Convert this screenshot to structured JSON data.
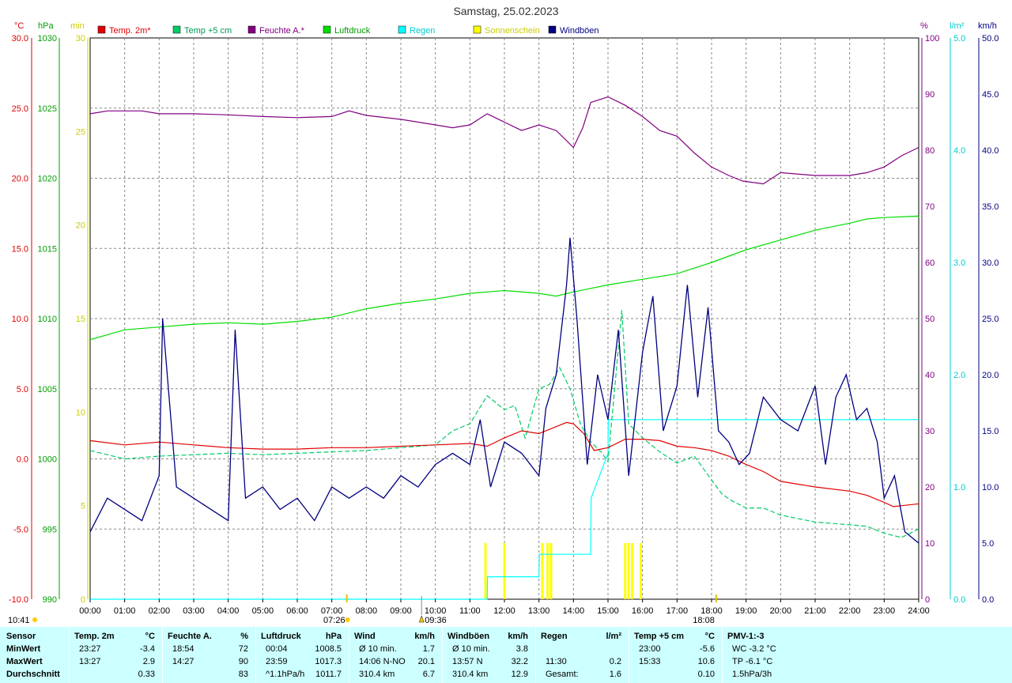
{
  "title": "Samstag, 25.02.2023",
  "legend": [
    {
      "label": "Temp. 2m*",
      "color": "#e00000",
      "text_color": "#e00000"
    },
    {
      "label": "Temp +5 cm",
      "color": "#00cc66",
      "text_color": "#009955"
    },
    {
      "label": "Feuchte A.*",
      "color": "#800080",
      "text_color": "#800080"
    },
    {
      "label": "Luftdruck",
      "color": "#00dd00",
      "text_color": "#009900"
    },
    {
      "label": "Regen",
      "color": "#00ffff",
      "text_color": "#00cccc"
    },
    {
      "label": "Sonnenschein",
      "color": "#ffff00",
      "text_color": "#cccc00"
    },
    {
      "label": "Windböen",
      "color": "#000080",
      "text_color": "#000080"
    }
  ],
  "axes": {
    "temp": {
      "unit": "°C",
      "color": "#e00000",
      "ticks": [
        "30.0",
        "25.0",
        "20.0",
        "15.0",
        "10.0",
        "5.0",
        "0.0",
        "-5.0",
        "-10.0"
      ]
    },
    "pressure": {
      "unit": "hPa",
      "color": "#00a000",
      "ticks": [
        "1030",
        "1025",
        "1020",
        "1015",
        "1010",
        "1005",
        "1000",
        "995",
        "990"
      ]
    },
    "sunmin": {
      "unit": "min",
      "color": "#cccc00",
      "ticks": [
        "30",
        "25",
        "20",
        "15",
        "10",
        "5",
        "0"
      ]
    },
    "humidity": {
      "unit": "%",
      "color": "#800080",
      "ticks": [
        "100",
        "90",
        "80",
        "70",
        "60",
        "50",
        "40",
        "30",
        "20",
        "10",
        "0"
      ]
    },
    "rain": {
      "unit": "l/m²",
      "color": "#00cccc",
      "ticks": [
        "5.0",
        "4.0",
        "3.0",
        "2.0",
        "1.0",
        "0.0"
      ]
    },
    "wind": {
      "unit": "km/h",
      "color": "#000080",
      "ticks": [
        "50.0",
        "45.0",
        "40.0",
        "35.0",
        "30.0",
        "25.0",
        "20.0",
        "15.0",
        "10.0",
        "5.0",
        "0.0"
      ]
    }
  },
  "x_ticks": [
    "00:00",
    "01:00",
    "02:00",
    "03:00",
    "04:00",
    "05:00",
    "06:00",
    "07:00",
    "08:00",
    "09:00",
    "10:00",
    "11:00",
    "12:00",
    "13:00",
    "14:00",
    "15:00",
    "16:00",
    "17:00",
    "18:00",
    "19:00",
    "20:00",
    "21:00",
    "22:00",
    "23:00",
    "24:00"
  ],
  "time_markers": {
    "now": "10:41",
    "sunrise": "07:26",
    "noon": "09:36",
    "sunset": "18:08"
  },
  "chart_data": {
    "type": "line",
    "x_range": [
      "00:00",
      "24:00"
    ],
    "grid": true,
    "legend_position": "top",
    "series": [
      {
        "name": "Temp. 2m*",
        "unit": "°C",
        "x": [
          0,
          1,
          2,
          3,
          4,
          5,
          6,
          7,
          8,
          9,
          10,
          11,
          11.5,
          12,
          12.5,
          13,
          13.5,
          13.8,
          14,
          14.3,
          14.6,
          15,
          15.5,
          16,
          16.5,
          17,
          17.5,
          18,
          18.5,
          19,
          19.5,
          20,
          21,
          22,
          22.5,
          23,
          23.27,
          24
        ],
        "y": [
          1.3,
          1.0,
          1.2,
          1.0,
          0.8,
          0.7,
          0.7,
          0.8,
          0.8,
          0.9,
          1.0,
          1.1,
          0.9,
          1.5,
          2.0,
          1.8,
          2.3,
          2.6,
          2.5,
          1.8,
          0.6,
          0.8,
          1.4,
          1.4,
          1.3,
          0.9,
          0.8,
          0.6,
          0.2,
          -0.4,
          -0.9,
          -1.6,
          -2.0,
          -2.3,
          -2.6,
          -3.1,
          -3.4,
          -3.2
        ]
      },
      {
        "name": "Temp +5 cm",
        "unit": "°C",
        "x": [
          0,
          0.5,
          1,
          2,
          3,
          4,
          5,
          6,
          7,
          8,
          9,
          10,
          10.5,
          11,
          11.5,
          12,
          12.3,
          12.6,
          13,
          13.3,
          13.6,
          13.9,
          14.2,
          14.5,
          14.8,
          15,
          15.4,
          15.6,
          16,
          16.5,
          17,
          17.5,
          18,
          18.3,
          18.6,
          19,
          19.5,
          20,
          21,
          22,
          22.5,
          23,
          23.5,
          24
        ],
        "y": [
          0.6,
          0.3,
          0.0,
          0.2,
          0.3,
          0.4,
          0.3,
          0.4,
          0.5,
          0.6,
          0.8,
          1.0,
          2.0,
          2.5,
          4.5,
          3.5,
          3.8,
          1.5,
          5.0,
          5.3,
          6.5,
          5.0,
          2.5,
          1.2,
          0.5,
          -0.2,
          10.6,
          2.5,
          1.5,
          0.5,
          -0.3,
          0.2,
          -1.5,
          -2.5,
          -3.0,
          -3.5,
          -3.5,
          -4.0,
          -4.5,
          -4.7,
          -4.8,
          -5.3,
          -5.6,
          -5.0
        ]
      },
      {
        "name": "Feuchte A.*",
        "unit": "%",
        "x": [
          0,
          0.5,
          1,
          1.5,
          2,
          3,
          4,
          5,
          6,
          7,
          7.5,
          8,
          9,
          10,
          10.5,
          11,
          11.5,
          12,
          12.5,
          13,
          13.5,
          14,
          14.27,
          14.5,
          15,
          15.5,
          16,
          16.5,
          17,
          17.5,
          18,
          18.5,
          18.9,
          19.5,
          20,
          21,
          22,
          22.5,
          23,
          23.5,
          24
        ],
        "y": [
          86.5,
          87,
          87,
          87,
          86.5,
          86.5,
          86.3,
          86,
          85.8,
          86,
          87,
          86.2,
          85.5,
          84.5,
          84,
          84.5,
          86.5,
          85,
          83.5,
          84.5,
          83.5,
          80.5,
          84,
          88.5,
          89.5,
          88,
          86,
          83.5,
          82.5,
          79.5,
          77,
          75.5,
          74.5,
          74,
          76,
          75.5,
          75.5,
          76,
          77,
          79,
          80.5
        ]
      },
      {
        "name": "Luftdruck",
        "unit": "hPa",
        "x": [
          0,
          0.004,
          1,
          2,
          3,
          4,
          5,
          6,
          7,
          8,
          9,
          10,
          11,
          12,
          13,
          13.5,
          14,
          15,
          16,
          17,
          18,
          19,
          20,
          21,
          22,
          22.5,
          23,
          23.98,
          24
        ],
        "y": [
          1008.5,
          1008.5,
          1009.2,
          1009.4,
          1009.6,
          1009.7,
          1009.6,
          1009.8,
          1010.1,
          1010.7,
          1011.1,
          1011.4,
          1011.8,
          1012.0,
          1011.8,
          1011.6,
          1011.9,
          1012.4,
          1012.8,
          1013.2,
          1014.0,
          1014.9,
          1015.6,
          1016.3,
          1016.8,
          1017.1,
          1017.2,
          1017.3,
          1017.2
        ]
      },
      {
        "name": "Regen",
        "unit": "l/m²",
        "x": [
          0,
          11.5,
          11.51,
          13.0,
          13.01,
          14.5,
          14.51,
          15.0,
          15.01,
          16.0,
          24
        ],
        "y": [
          0,
          0,
          0.2,
          0.2,
          0.4,
          0.4,
          0.9,
          1.3,
          1.6,
          1.6,
          1.6
        ]
      },
      {
        "name": "Sonnenschein",
        "unit": "min",
        "bars": [
          [
            11.45,
            3
          ],
          [
            12.0,
            3
          ],
          [
            13.1,
            3
          ],
          [
            13.25,
            3
          ],
          [
            13.35,
            3
          ],
          [
            15.5,
            3
          ],
          [
            15.6,
            3
          ],
          [
            15.7,
            3
          ],
          [
            15.95,
            3
          ]
        ]
      },
      {
        "name": "Windböen",
        "unit": "km/h",
        "x": [
          0,
          0.5,
          1,
          1.5,
          2,
          2.1,
          2.5,
          3,
          3.5,
          4,
          4.2,
          4.5,
          5,
          5.5,
          6,
          6.5,
          7,
          7.5,
          8,
          8.5,
          9,
          9.5,
          10,
          10.5,
          11,
          11.3,
          11.6,
          12,
          12.5,
          13,
          13.2,
          13.5,
          13.8,
          13.9,
          14.1,
          14.4,
          14.7,
          15,
          15.3,
          15.6,
          16,
          16.3,
          16.6,
          17,
          17.3,
          17.6,
          17.9,
          18.2,
          18.5,
          18.8,
          19.1,
          19.5,
          20,
          20.5,
          21,
          21.3,
          21.6,
          21.9,
          22.2,
          22.5,
          22.8,
          23.0,
          23.3,
          23.6,
          24
        ],
        "y": [
          6,
          9,
          8,
          7,
          11,
          25,
          10,
          9,
          8,
          7,
          24,
          9,
          10,
          8,
          9,
          7,
          10,
          9,
          10,
          9,
          11,
          10,
          12,
          13,
          12,
          16,
          10,
          14,
          13,
          11,
          17,
          20,
          28,
          32.2,
          25,
          12,
          20,
          16,
          24,
          11,
          22,
          27,
          15,
          19,
          28,
          18,
          26,
          15,
          14,
          12,
          13,
          18,
          16,
          15,
          19,
          12,
          18,
          20,
          16,
          17,
          14,
          9,
          11,
          6,
          5
        ]
      }
    ]
  },
  "stats": {
    "rows": [
      "Sensor",
      "MinWert",
      "MaxWert",
      "Durchschnitt"
    ],
    "columns": [
      {
        "h1": "Temp. 2m",
        "h2": "°C",
        "rows": [
          [
            "23:27",
            "-3.4"
          ],
          [
            "13:27",
            "2.9"
          ],
          [
            "",
            "0.33"
          ]
        ]
      },
      {
        "h1": "Feuchte A.",
        "h2": "%",
        "rows": [
          [
            "18:54",
            "72"
          ],
          [
            "14:27",
            "90"
          ],
          [
            "",
            "83"
          ]
        ]
      },
      {
        "h1": "Luftdruck",
        "h2": "hPa",
        "rows": [
          [
            "00:04",
            "1008.5"
          ],
          [
            "23:59",
            "1017.3"
          ],
          [
            "^1.1hPa/h",
            "1011.7"
          ]
        ]
      },
      {
        "h1": "Wind",
        "h2": "km/h",
        "rows": [
          [
            "Ø 10 min.",
            "1.7"
          ],
          [
            "14:06     N-NO",
            "20.1"
          ],
          [
            "310.4 km",
            "6.7"
          ]
        ]
      },
      {
        "h1": "Windböen",
        "h2": "km/h",
        "rows": [
          [
            "Ø 10 min.",
            "3.8"
          ],
          [
            "13:57          N",
            "32.2"
          ],
          [
            "310.4 km",
            "12.9"
          ]
        ]
      },
      {
        "h1": "Regen",
        "h2": "l/m²",
        "rows": [
          [
            "",
            ""
          ],
          [
            "11:30",
            "0.2"
          ],
          [
            "Gesamt:",
            "1.6"
          ]
        ]
      },
      {
        "h1": "Temp +5 cm",
        "h2": "°C",
        "rows": [
          [
            "23:00",
            "-5.6"
          ],
          [
            "15:33",
            "10.6"
          ],
          [
            "",
            "0.10"
          ]
        ]
      },
      {
        "h1": "PMV-1:-3",
        "h2": "",
        "rows": [
          [
            "WC -3.2 °C",
            ""
          ],
          [
            "TP -6.1 °C",
            ""
          ],
          [
            "1.5hPa/3h",
            ""
          ]
        ]
      }
    ]
  }
}
